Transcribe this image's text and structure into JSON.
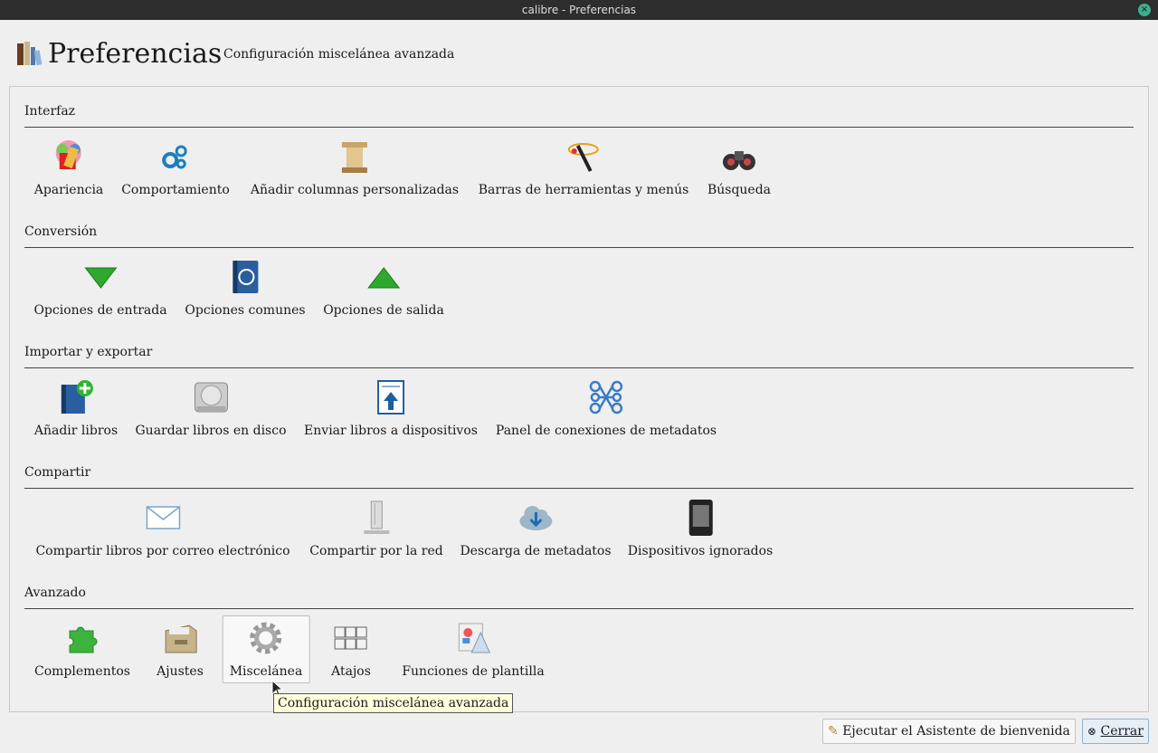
{
  "window": {
    "title": "calibre - Preferencias"
  },
  "header": {
    "title": "Preferencias",
    "subtitle": "Configuración miscelánea avanzada"
  },
  "sections": [
    {
      "title": "Interfaz",
      "items": [
        {
          "label": "Apariencia",
          "icon": "appearance-icon"
        },
        {
          "label": "Comportamiento",
          "icon": "gears-icon"
        },
        {
          "label": "Añadir columnas personalizadas",
          "icon": "column-icon"
        },
        {
          "label": "Barras de herramientas y menús",
          "icon": "wand-icon"
        },
        {
          "label": "Búsqueda",
          "icon": "binoculars-icon"
        }
      ]
    },
    {
      "title": "Conversión",
      "items": [
        {
          "label": "Opciones de entrada",
          "icon": "arrow-down-icon"
        },
        {
          "label": "Opciones comunes",
          "icon": "convert-book-icon"
        },
        {
          "label": "Opciones de salida",
          "icon": "arrow-up-icon"
        }
      ]
    },
    {
      "title": "Importar y exportar",
      "items": [
        {
          "label": "Añadir libros",
          "icon": "add-book-icon"
        },
        {
          "label": "Guardar libros en disco",
          "icon": "hard-disk-icon"
        },
        {
          "label": "Enviar libros a dispositivos",
          "icon": "send-to-device-icon"
        },
        {
          "label": "Panel de conexiones de metadatos",
          "icon": "plugboard-icon"
        }
      ]
    },
    {
      "title": "Compartir",
      "items": [
        {
          "label": "Compartir libros por correo electrónico",
          "icon": "mail-icon"
        },
        {
          "label": "Compartir por la red",
          "icon": "network-server-icon"
        },
        {
          "label": "Descarga de metadatos",
          "icon": "cloud-download-icon"
        },
        {
          "label": "Dispositivos ignorados",
          "icon": "ereader-icon"
        }
      ]
    },
    {
      "title": "Avanzado",
      "items": [
        {
          "label": "Complementos",
          "icon": "puzzle-icon"
        },
        {
          "label": "Ajustes",
          "icon": "drawer-icon"
        },
        {
          "label": "Miscelánea",
          "icon": "gear-icon",
          "selected": true
        },
        {
          "label": "Atajos",
          "icon": "keyboard-icon"
        },
        {
          "label": "Funciones de plantilla",
          "icon": "template-icon"
        }
      ]
    }
  ],
  "tooltip": "Configuración miscelánea avanzada",
  "buttons": {
    "wizard": "Ejecutar el Asistente de bienvenida",
    "close": "Cerrar"
  }
}
